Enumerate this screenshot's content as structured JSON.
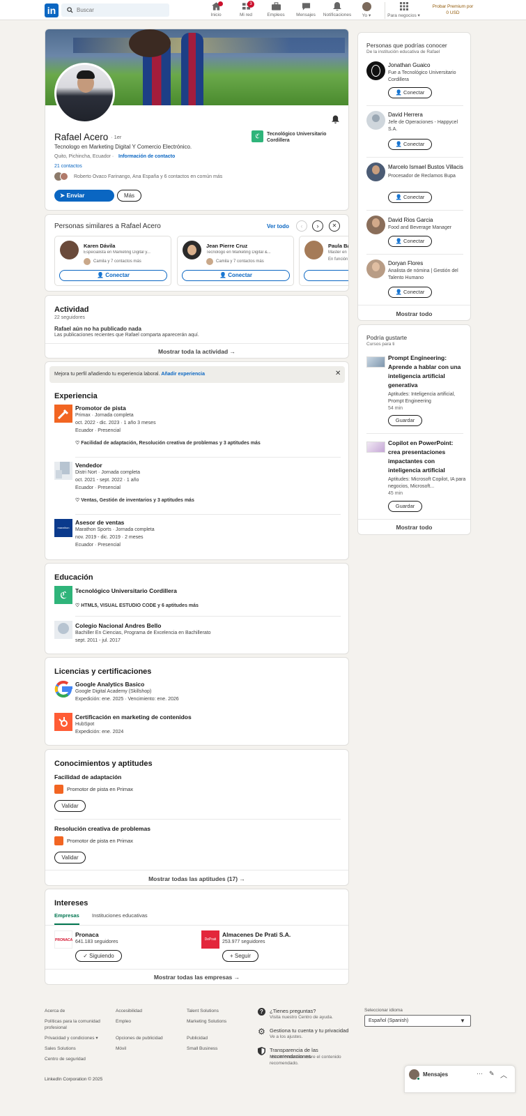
{
  "header": {
    "logo_text": "in",
    "search_placeholder": "Buscar",
    "nav": [
      {
        "label": "Inicio",
        "badge": ""
      },
      {
        "label": "Mi red",
        "badge": "3"
      },
      {
        "label": "Empleos",
        "badge": ""
      },
      {
        "label": "Mensajes",
        "badge": ""
      },
      {
        "label": "Notificaciones",
        "badge": ""
      },
      {
        "label": "Yo",
        "badge": ""
      },
      {
        "label": "Para negocios",
        "badge": ""
      }
    ],
    "premium": "Probar Premium por 0 USD"
  },
  "profile": {
    "name": "Rafael Acero",
    "degree": "· 1er",
    "headline": "Tecnologo en Marketing Digital Y Comercio Electrónico.",
    "location": "Quito, Pichincha, Ecuador ·",
    "contact_info": "Información de contacto",
    "contacts": "21 contactos",
    "mutual": "Roberto Ovaco Farinango, Ana España y 6 contactos en común más",
    "school": "Tecnológico Universitario Cordillera",
    "send_message": "Enviar mensaje",
    "more": "Más"
  },
  "similar": {
    "title": "Personas similares a Rafael Acero",
    "see_all": "Ver todo",
    "people": [
      {
        "name": "Karen Dávila",
        "headline": "Especialista en Marketing Digital y...",
        "mutual": "Camila y 7 contactos más",
        "action": "Conectar"
      },
      {
        "name": "Jean Pierre Cruz",
        "headline": "Tecnólogo en Marketing Digital &...",
        "mutual": "Camila y 7 contactos más",
        "action": "Conectar"
      },
      {
        "name": "Paula Ba",
        "headline": "Master en",
        "mutual": "En función",
        "action": ""
      }
    ]
  },
  "activity": {
    "title": "Actividad",
    "followers": "22 seguidores",
    "empty_title": "Rafael aún no ha publicado nada",
    "empty_desc": "Las publicaciones recientes que Rafael comparta aparecerán aquí.",
    "show_all": "Mostrar toda la actividad →"
  },
  "experience": {
    "banner": "Mejora tu perfil añadiendo tu experiencia laboral.",
    "banner_link": "Añadir experiencia",
    "title": "Experiencia",
    "items": [
      {
        "role": "Promotor de pista",
        "company": "Primax · Jornada completa",
        "dates": "oct. 2022 - dic. 2023 · 1 año 3 meses",
        "place": "Ecuador · Presencial",
        "skills": "Facilidad de adaptación, Resolución creativa de problemas y 3 aptitudes más"
      },
      {
        "role": "Vendedor",
        "company": "Distri Nort · Jornada completa",
        "dates": "oct. 2021 - sept. 2022 · 1 año",
        "place": "Ecuador · Presencial",
        "skills": "Ventas, Gestión de inventarios y 3 aptitudes más"
      },
      {
        "role": "Asesor de ventas",
        "company": "Marathon Sports · Jornada completa",
        "dates": "nov. 2019 - dic. 2019 · 2 meses",
        "place": "Ecuador · Presencial",
        "skills": "",
        "logo_text": "marathon"
      }
    ]
  },
  "education": {
    "title": "Educación",
    "items": [
      {
        "school": "Tecnológico Universitario Cordillera",
        "skills": "HTML5, VISUAL ESTUDIO CODE y 6 aptitudes más"
      },
      {
        "school": "Colegio Nacional Andres Bello",
        "degree": "Bachiller En Ciencias, Programa de Excelencia en Bachillerato",
        "dates": "sept. 2011 - jul. 2017"
      }
    ]
  },
  "licenses": {
    "title": "Licencias y certificaciones",
    "items": [
      {
        "name": "Google Analytics Basico",
        "issuer": "Google Digital Academy (Skillshop)",
        "dates": "Expedición: ene. 2025 · Vencimiento: ene. 2026"
      },
      {
        "name": "Certificación en marketing de contenidos",
        "issuer": "HubSpot",
        "dates": "Expedición: ene. 2024"
      }
    ]
  },
  "skills": {
    "title": "Conocimientos y aptitudes",
    "items": [
      {
        "name": "Facilidad de adaptación",
        "source": "Promotor de pista en Primax",
        "action": "Validar"
      },
      {
        "name": "Resolución creativa de problemas",
        "source": "Promotor de pista en Primax",
        "action": "Validar"
      }
    ],
    "show_all": "Mostrar todas las aptitudes (17) →"
  },
  "interests": {
    "title": "Intereses",
    "tabs": [
      "Empresas",
      "Instituciones educativas"
    ],
    "items": [
      {
        "name": "Pronaca",
        "followers": "641.183 seguidores",
        "action": "✓ Siguiendo",
        "logo_text": "PRONACA"
      },
      {
        "name": "Almacenes De Prati S.A.",
        "followers": "253.977 seguidores",
        "action": "+ Seguir",
        "logo_text": "DePrati"
      }
    ],
    "show_all": "Mostrar todas las empresas →"
  },
  "pymk": {
    "title": "Personas que podrías conocer",
    "subtitle": "De la institución educativa de Rafael",
    "people": [
      {
        "name": "Jonathan Guaico",
        "headline": "Fue a Tecnológico Universitario Cordillera",
        "action": "Conectar"
      },
      {
        "name": "David Herrera",
        "headline": "Jefe de Operaciones - Happycel S.A.",
        "action": "Conectar"
      },
      {
        "name": "Marcelo Ismael Bustos Villacis",
        "headline": "Procesador de Reclamos Bupa",
        "action": "Conectar"
      },
      {
        "name": "David Rios Garcia",
        "headline": "Food and Beverage Manager",
        "action": "Conectar"
      },
      {
        "name": "Doryan Flores",
        "headline": "Analista de nómina | Gestión del Talento Humano",
        "action": "Conectar"
      }
    ],
    "show_all": "Mostrar todo"
  },
  "courses": {
    "title": "Podría gustarte",
    "subtitle": "Cursos para ti",
    "items": [
      {
        "title": "Prompt Engineering: Aprende a hablar con una inteligencia artificial generativa",
        "skills": "Aptitudes: Inteligencia artificial, Prompt Engineering",
        "duration": "54 min",
        "action": "Guardar"
      },
      {
        "title": "Copilot en PowerPoint: crea presentaciones impactantes con inteligencia artificial",
        "skills": "Aptitudes: Microsoft Copilot, IA para negocios, Microsoft...",
        "duration": "45 min",
        "action": "Guardar"
      }
    ],
    "show_all": "Mostrar todo"
  },
  "footer": {
    "col1": [
      "Acerca de",
      "Políticas para la comunidad profesional",
      "Privacidad y condiciones",
      "Sales Solutions",
      "Centro de seguridad"
    ],
    "col2": [
      "Accesibilidad",
      "Empleo",
      "Opciones de publicidad",
      "Móvil"
    ],
    "col3": [
      "Talent Solutions",
      "Marketing Solutions",
      "Publicidad",
      "Small Business"
    ],
    "help": [
      {
        "title": "¿Tienes preguntas?",
        "desc": "Visita nuestro Centro de ayuda."
      },
      {
        "title": "Gestiona tu cuenta y tu privacidad",
        "desc": "Ve a los ajustes."
      },
      {
        "title": "Transparencia de las recomendaciones",
        "desc": "Más información sobre el contenido recomendado."
      }
    ],
    "lang_label": "Seleccionar idioma",
    "lang_value": "Español (Spanish)",
    "copyright": "LinkedIn Corporation © 2025"
  },
  "messaging": {
    "label": "Mensajes"
  },
  "colors": {
    "brand": "#0a66c2",
    "background": "#f4f2ee",
    "badge": "#cb112d",
    "premium": "#915907"
  }
}
